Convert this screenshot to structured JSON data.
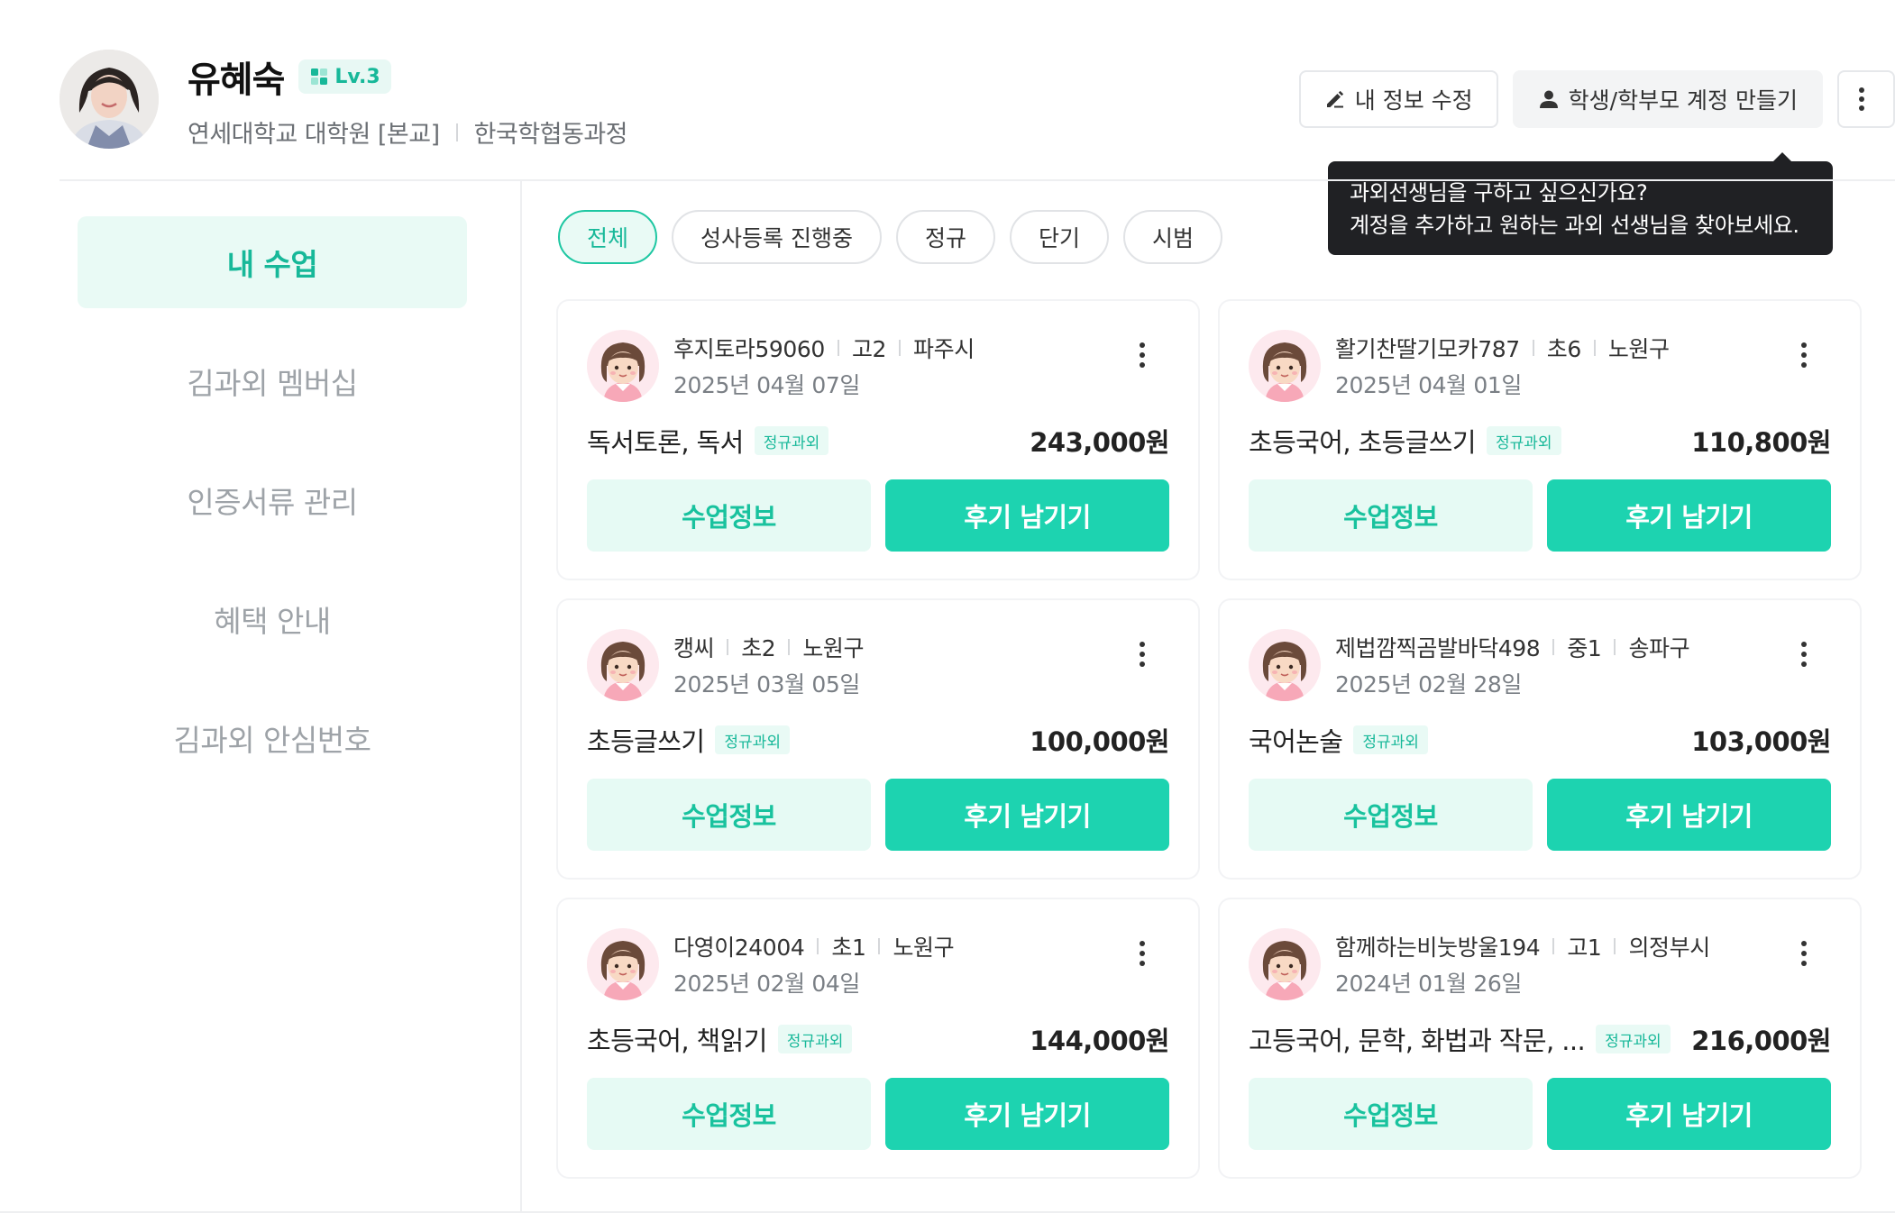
{
  "profile": {
    "name": "유혜숙",
    "level": "Lv.3",
    "school": "연세대학교 대학원 [본교]",
    "department": "한국학협동과정"
  },
  "header": {
    "edit_label": "내 정보 수정",
    "create_account_label": "학생/학부모 계정 만들기",
    "tooltip_line1": "과외선생님을 구하고 싶으신가요?",
    "tooltip_line2": "계정을 추가하고 원하는 과외 선생님을 찾아보세요."
  },
  "sidebar": {
    "items": [
      {
        "label": "내 수업",
        "active": true
      },
      {
        "label": "김과외 멤버십"
      },
      {
        "label": "인증서류 관리"
      },
      {
        "label": "혜택 안내"
      },
      {
        "label": "김과외 안심번호"
      }
    ]
  },
  "filters": [
    {
      "label": "전체",
      "active": true
    },
    {
      "label": "성사등록 진행중"
    },
    {
      "label": "정규"
    },
    {
      "label": "단기"
    },
    {
      "label": "시범"
    }
  ],
  "card_buttons": {
    "info_label": "수업정보",
    "review_label": "후기 남기기"
  },
  "lessons": [
    {
      "nickname": "후지토라59060",
      "grade": "고2",
      "region": "파주시",
      "date": "2025년 04월 07일",
      "subject": "독서토론, 독서",
      "type": "정규과외",
      "price": "243,000원"
    },
    {
      "nickname": "활기찬딸기모카787",
      "grade": "초6",
      "region": "노원구",
      "date": "2025년 04월 01일",
      "subject": "초등국어, 초등글쓰기",
      "type": "정규과외",
      "price": "110,800원"
    },
    {
      "nickname": "캥씨",
      "grade": "초2",
      "region": "노원구",
      "date": "2025년 03월 05일",
      "subject": "초등글쓰기",
      "type": "정규과외",
      "price": "100,000원"
    },
    {
      "nickname": "제법깜찍곰발바닥498",
      "grade": "중1",
      "region": "송파구",
      "date": "2025년 02월 28일",
      "subject": "국어논술",
      "type": "정규과외",
      "price": "103,000원"
    },
    {
      "nickname": "다영이24004",
      "grade": "초1",
      "region": "노원구",
      "date": "2025년 02월 04일",
      "subject": "초등국어, 책읽기",
      "type": "정규과외",
      "price": "144,000원"
    },
    {
      "nickname": "함께하는비눗방울194",
      "grade": "고1",
      "region": "의정부시",
      "date": "2024년 01월 26일",
      "subject": "고등국어, 문학, 화법과 작문, ...",
      "type": "정규과외",
      "price": "216,000원"
    }
  ],
  "colors": {
    "accent": "#1dd3b0",
    "accent_text": "#17b899",
    "accent_light": "#e9faf5",
    "tooltip_bg": "#202124"
  }
}
